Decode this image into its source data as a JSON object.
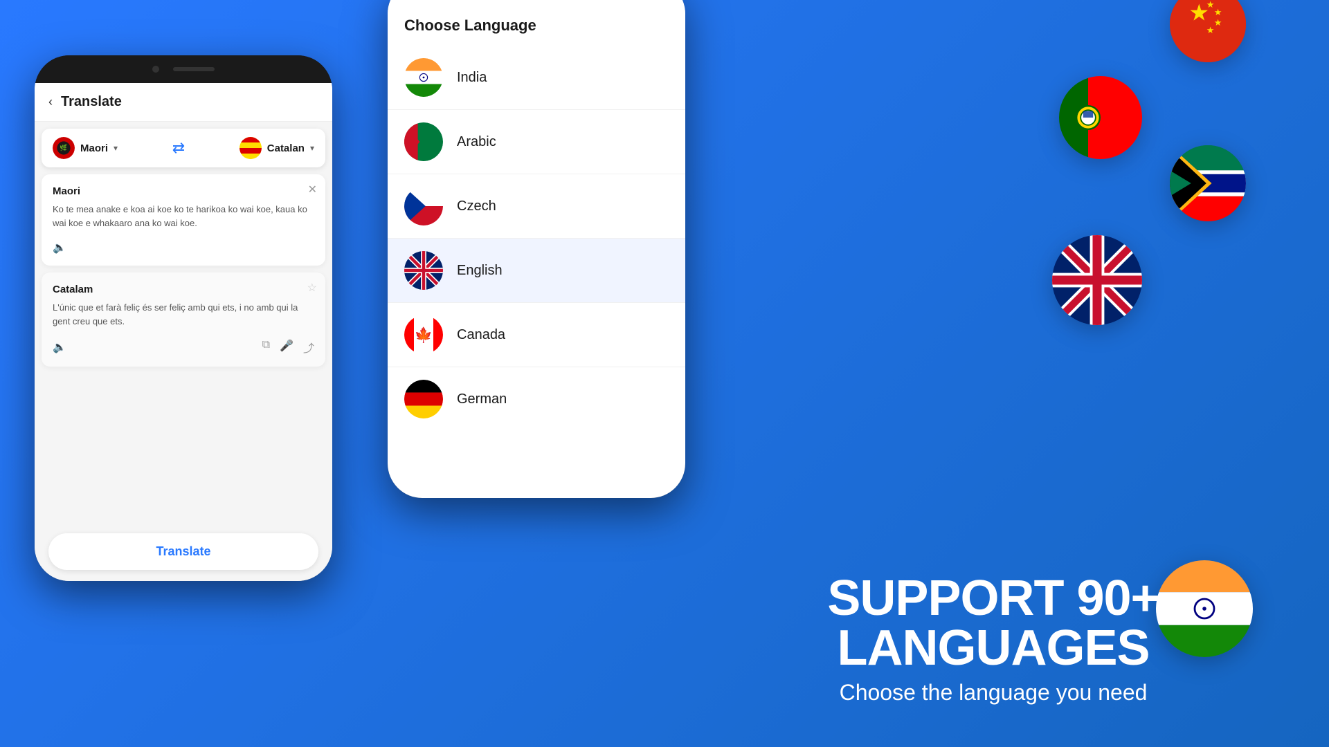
{
  "app": {
    "title": "Translate",
    "background_color": "#2979FF"
  },
  "left_phone": {
    "header": {
      "back_label": "‹",
      "title": "Translate"
    },
    "lang_selector": {
      "source_lang": "Maori",
      "target_lang": "Catalan",
      "swap_icon": "⇄"
    },
    "source_card": {
      "lang_label": "Maori",
      "text": "Ko te mea anake e koa ai koe ko te harikoa ko wai koe, kaua ko wai koe e whakaaro ana ko wai koe.",
      "close_icon": "✕"
    },
    "target_card": {
      "lang_label": "Catalam",
      "text": "L'únic que et farà feliç és ser feliç amb qui ets, i no amb qui la gent creu que ets.",
      "star_icon": "☆"
    },
    "translate_button": "Translate"
  },
  "right_phone": {
    "header": "Choose Language",
    "languages": [
      {
        "name": "India",
        "code": "in"
      },
      {
        "name": "Arabic",
        "code": "ar"
      },
      {
        "name": "Czech",
        "code": "cz"
      },
      {
        "name": "English",
        "code": "gb"
      },
      {
        "name": "Canada",
        "code": "ca"
      },
      {
        "name": "German",
        "code": "de"
      }
    ]
  },
  "floating_flags": {
    "china": "cn",
    "portugal": "pt",
    "south_africa": "za",
    "uk": "gb",
    "india": "in"
  },
  "support_section": {
    "title": "SUPPORT 90+ LANGUAGES",
    "subtitle": "Choose the language you need"
  }
}
